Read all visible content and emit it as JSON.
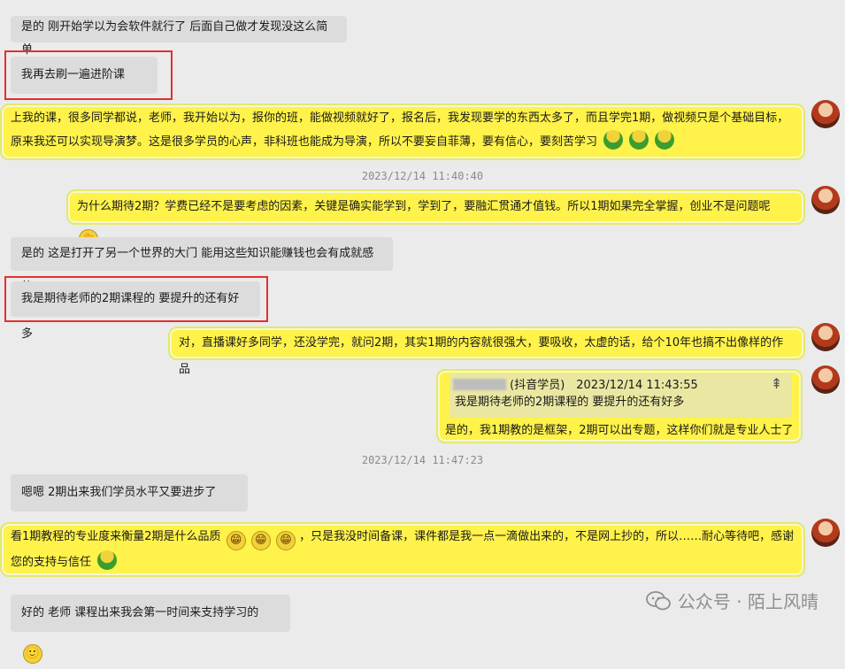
{
  "messages": {
    "m1": "是的 刚开始学以为会软件就行了 后面自己做才发现没这么简单",
    "m2": "我再去刷一遍进阶课",
    "m3": "上我的课，很多同学都说，老师，我开始以为，报你的班，能做视频就好了，报名后，我发现要学的东西太多了，而且学完1期，做视频只是个基础目标，原来我还可以实现导演梦。这是很多学员的心声，非科班也能成为导演，所以不要妄自菲薄，要有信心，要刻苦学习",
    "m4": "为什么期待2期？学费已经不是要考虑的因素，关键是确实能学到，学到了，要融汇贯通才值钱。所以1期如果完全掌握，创业不是问题呢",
    "m5": "是的 这是打开了另一个世界的大门 能用这些知识能赚钱也会有成就感的",
    "m6": "我是期待老师的2期课程的 要提升的还有好多",
    "m7": "对，直播课好多同学，还没学完，就问2期，其实1期的内容就很强大，要吸收，太虚的话，给个10年也搞不出像样的作品",
    "m8_quote_meta": "(抖音学员)　2023/12/14 11:43:55",
    "m8_quote_text": "我是期待老师的2期课程的 要提升的还有好多",
    "m8": "是的，我1期教的是框架，2期可以出专题，这样你们就是专业人士了",
    "m9": "嗯嗯 2期出来我们学员水平又要进步了",
    "m10": "看1期教程的专业度来衡量2期是什么品质",
    "m10b": "，只是我没时间备课，课件都是我一点一滴做出来的，不是网上抄的，所以……耐心等待吧，感谢您的支持与信任",
    "m11": "好的 老师 课程出来我会第一时间来支持学习的"
  },
  "timestamps": [
    "2023/12/14 11:40:40",
    "2023/12/14 11:47:23"
  ],
  "watermark": "公众号 · 陌上风晴",
  "icons": {
    "grin": "😁",
    "smile": "🙂",
    "clap": "👏",
    "pin": "⇞"
  }
}
